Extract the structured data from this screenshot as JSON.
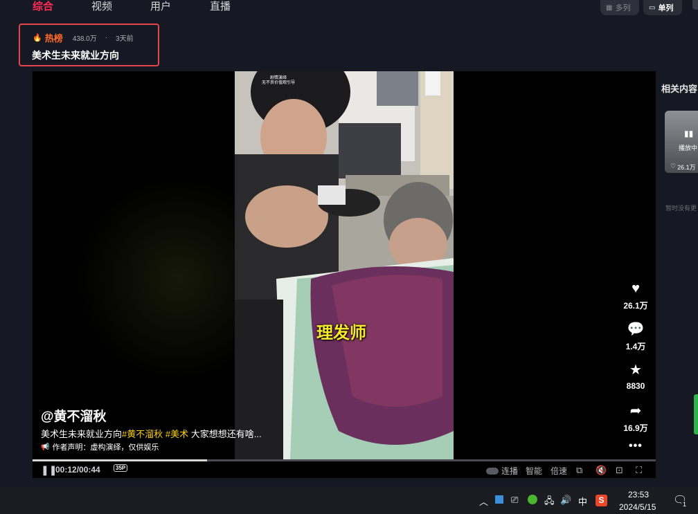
{
  "tabs": [
    {
      "label": "综合",
      "active": true
    },
    {
      "label": "视频",
      "active": false
    },
    {
      "label": "用户",
      "active": false
    },
    {
      "label": "直播",
      "active": false
    }
  ],
  "view_toggle": {
    "multi": "多列",
    "single": "单列"
  },
  "hot": {
    "badge": "热榜",
    "count": "438.0万",
    "sep": "·",
    "time": "3天前",
    "title": "美术生未来就业方向"
  },
  "video": {
    "watermark_line1": "剧情演绎",
    "watermark_line2": "无不良价值观引导",
    "caption": "理发师",
    "author": "@黄不溜秋",
    "desc_text": "美术生未来就业方向",
    "tag1": "#黄不溜秋",
    "tag2": "#美术",
    "desc_more": "大家想想还有啥...",
    "disclaimer": "作者声明：虚构演绎，仅供娱乐",
    "progress_fraction": 0.28,
    "time": "00:12/00:44",
    "controls": {
      "speed_badge": "35P",
      "autoplay": "连播",
      "smart": "智能",
      "rate": "倍速"
    },
    "actions": {
      "likes": "26.1万",
      "comments": "1.4万",
      "favorites": "8830",
      "shares": "16.9万"
    }
  },
  "related": {
    "title": "相关内容",
    "card_status": "播放中",
    "card_likes": "26.1万",
    "empty_text": "暂时没有更"
  },
  "taskbar": {
    "ime": "中",
    "time": "23:53",
    "date": "2024/5/15",
    "notification_count": "1"
  },
  "colors": {
    "accent": "#fe2c55",
    "tag": "#face15",
    "caption": "#f7ea2a",
    "hotbox": "#e8444b"
  }
}
